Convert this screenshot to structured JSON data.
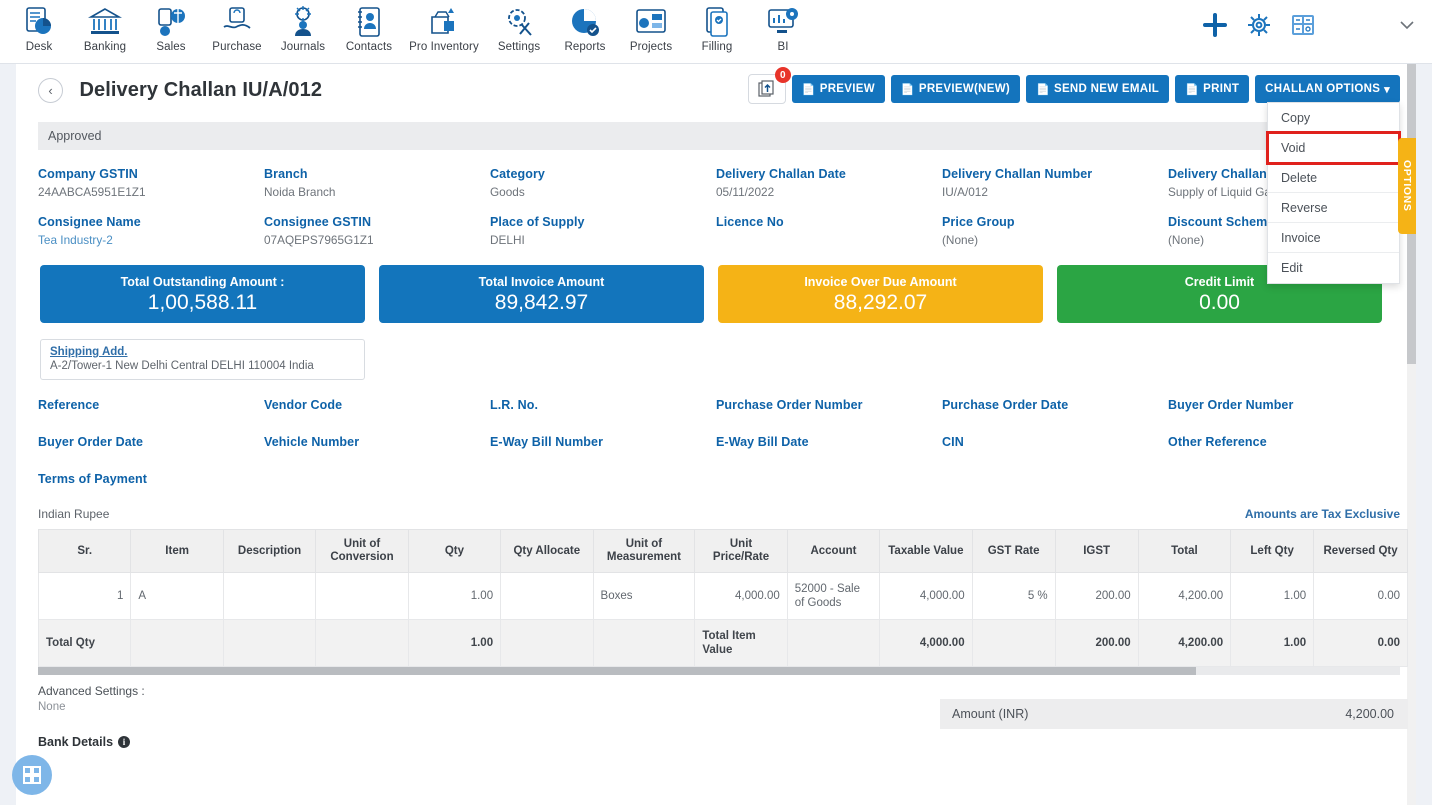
{
  "topnav": {
    "items": [
      {
        "label": "Desk",
        "icon": "desk-icon"
      },
      {
        "label": "Banking",
        "icon": "bank-icon"
      },
      {
        "label": "Sales",
        "icon": "sales-icon"
      },
      {
        "label": "Purchase",
        "icon": "purchase-icon"
      },
      {
        "label": "Journals",
        "icon": "journals-icon"
      },
      {
        "label": "Contacts",
        "icon": "contacts-icon"
      },
      {
        "label": "Pro Inventory",
        "icon": "inventory-icon"
      },
      {
        "label": "Settings",
        "icon": "settings-icon"
      },
      {
        "label": "Reports",
        "icon": "reports-icon"
      },
      {
        "label": "Projects",
        "icon": "projects-icon"
      },
      {
        "label": "Filling",
        "icon": "filling-icon"
      },
      {
        "label": "BI",
        "icon": "bi-icon"
      }
    ],
    "right_icons": [
      {
        "name": "add-icon"
      },
      {
        "name": "gear-icon"
      },
      {
        "name": "calculator-icon"
      },
      {
        "name": "chevron-down-icon"
      }
    ]
  },
  "header": {
    "back_label": "‹",
    "title": "Delivery Challan IU/A/012",
    "attachment_count": "0",
    "buttons": [
      {
        "label": "PREVIEW",
        "icon": "document-icon"
      },
      {
        "label": "PREVIEW(NEW)",
        "icon": "document-icon"
      },
      {
        "label": "SEND NEW EMAIL",
        "icon": "document-icon"
      },
      {
        "label": "PRINT",
        "icon": "document-icon"
      },
      {
        "label": "CHALLAN OPTIONS",
        "icon": "caret-down-icon"
      }
    ]
  },
  "dropdown": {
    "items": [
      {
        "label": "Copy",
        "highlighted": false
      },
      {
        "label": "Void",
        "highlighted": true
      },
      {
        "label": "Delete",
        "highlighted": false
      },
      {
        "label": "Reverse",
        "highlighted": false
      },
      {
        "label": "Invoice",
        "highlighted": false
      },
      {
        "label": "Edit",
        "highlighted": false
      }
    ]
  },
  "options_tab": {
    "label": "OPTIONS"
  },
  "status": {
    "label": "Approved"
  },
  "fields": [
    {
      "label": "Company GSTIN",
      "value": "24AABCA5951E1Z1",
      "link": false
    },
    {
      "label": "Branch",
      "value": "Noida Branch",
      "link": false
    },
    {
      "label": "Category",
      "value": "Goods",
      "link": false
    },
    {
      "label": "Delivery Challan Date",
      "value": "05/11/2022",
      "link": false
    },
    {
      "label": "Delivery Challan Number",
      "value": "IU/A/012",
      "link": false
    },
    {
      "label": "Delivery Challan Type",
      "value": "Supply of Liquid Gas",
      "link": false
    },
    {
      "label": "Consignee Name",
      "value": "Tea Industry-2",
      "link": true
    },
    {
      "label": "Consignee GSTIN",
      "value": "07AQEPS7965G1Z1",
      "link": false
    },
    {
      "label": "Place of Supply",
      "value": "DELHI",
      "link": false
    },
    {
      "label": "Licence No",
      "value": "",
      "link": false
    },
    {
      "label": "Price Group",
      "value": "(None)",
      "link": false
    },
    {
      "label": "Discount Scheme",
      "value": "(None)",
      "link": false
    }
  ],
  "cards": [
    {
      "title": "Total Outstanding Amount :",
      "value": "1,00,588.11",
      "color": "#1375bc"
    },
    {
      "title": "Total Invoice Amount",
      "value": "89,842.97",
      "color": "#1375bc"
    },
    {
      "title": "Invoice Over Due Amount",
      "value": "88,292.07",
      "color": "#f5b316"
    },
    {
      "title": "Credit Limit",
      "value": "0.00",
      "color": "#2ba544"
    }
  ],
  "shipping": {
    "label": "Shipping Add.",
    "value": "A-2/Tower-1 New Delhi Central DELHI 110004 India"
  },
  "references": [
    "Reference",
    "Vendor Code",
    "L.R. No.",
    "Purchase Order Number",
    "Purchase Order Date",
    "Buyer Order Number",
    "Buyer Order Date",
    "Vehicle Number",
    "E-Way Bill Number",
    "E-Way Bill Date",
    "CIN",
    "Other Reference",
    "Terms of Payment"
  ],
  "table": {
    "currency_label": "Indian Rupee",
    "tax_note": "Amounts are Tax Exclusive",
    "columns": [
      "Sr.",
      "Item",
      "Description",
      "Unit of Conversion",
      "Qty",
      "Qty Allocate",
      "Unit of Measurement",
      "Unit Price/Rate",
      "Account",
      "Taxable Value",
      "GST Rate",
      "IGST",
      "Total",
      "Left Qty",
      "Reversed Qty"
    ],
    "rows": [
      {
        "sr": "1",
        "item": "A",
        "description": "",
        "unit_of_conversion": "",
        "qty": "1.00",
        "qty_allocate": "",
        "unit_of_measurement": "Boxes",
        "unit_price": "4,000.00",
        "account": "52000 - Sale of Goods",
        "taxable_value": "4,000.00",
        "gst_rate": "5 %",
        "igst": "200.00",
        "total": "4,200.00",
        "left_qty": "1.00",
        "reversed_qty": "0.00"
      }
    ],
    "totals": {
      "label": "Total Qty",
      "qty": "1.00",
      "item_value_label": "Total Item Value",
      "taxable_value": "4,000.00",
      "igst": "200.00",
      "total": "4,200.00",
      "left_qty": "1.00",
      "reversed_qty": "0.00"
    }
  },
  "footer": {
    "advanced_label": "Advanced Settings :",
    "advanced_value": "None",
    "bank_details_label": "Bank Details",
    "amount_label": "Amount (INR)",
    "amount_value": "4,200.00"
  }
}
